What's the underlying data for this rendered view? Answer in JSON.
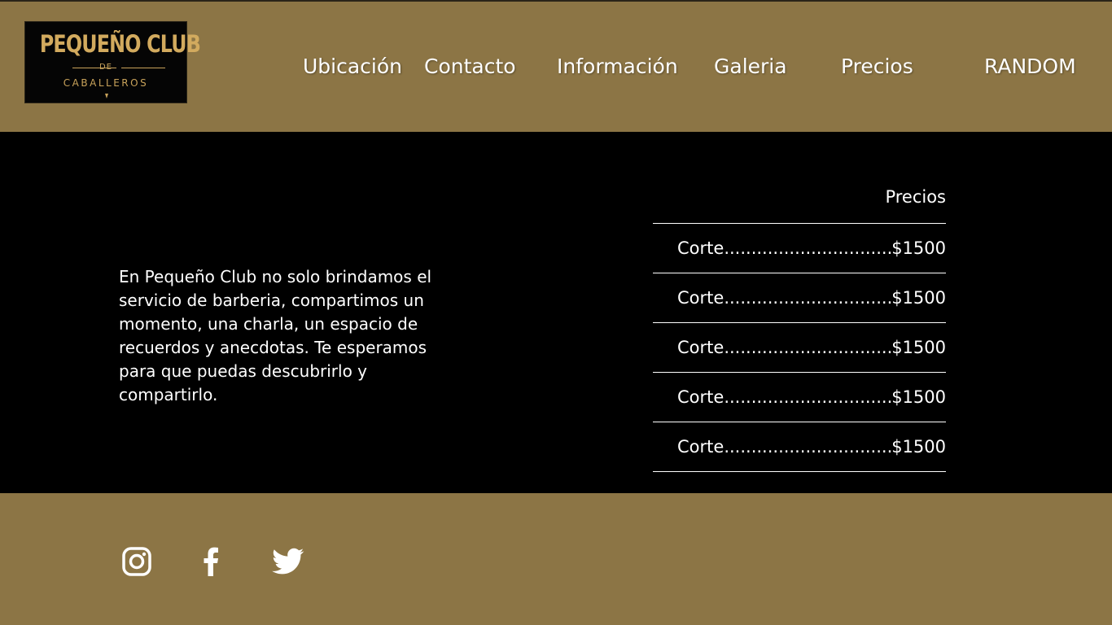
{
  "logo": {
    "title": "PEQUEÑO CLUB",
    "de": "DE",
    "subtitle": "CABALLEROS"
  },
  "nav": {
    "ubicacion": "Ubicación",
    "contacto": "Contacto",
    "informacion": "Información",
    "galeria": "Galeria",
    "precios": "Precios",
    "random": "RANDOM"
  },
  "intro": "En Pequeño Club no solo brindamos el servicio de barberia, compartimos un momento, una charla, un espacio de recuerdos y anecdotas. Te esperamos para que puedas descubrirlo y compartirlo.",
  "prices": {
    "title": "Precios",
    "items": [
      {
        "name": "Corte",
        "dots": "........................................",
        "price": "$1500"
      },
      {
        "name": "Corte",
        "dots": "........................................",
        "price": "$1500"
      },
      {
        "name": "Corte",
        "dots": "........................................",
        "price": "$1500"
      },
      {
        "name": "Corte",
        "dots": "........................................",
        "price": "$1500"
      },
      {
        "name": "Corte",
        "dots": "........................................",
        "price": "$1500"
      }
    ]
  },
  "footer": {
    "icons": [
      "instagram-icon",
      "facebook-icon",
      "twitter-icon"
    ]
  },
  "colors": {
    "gold": "#8c7545",
    "logo_gold": "#c8a25a",
    "background": "#000000",
    "text": "#ffffff"
  }
}
